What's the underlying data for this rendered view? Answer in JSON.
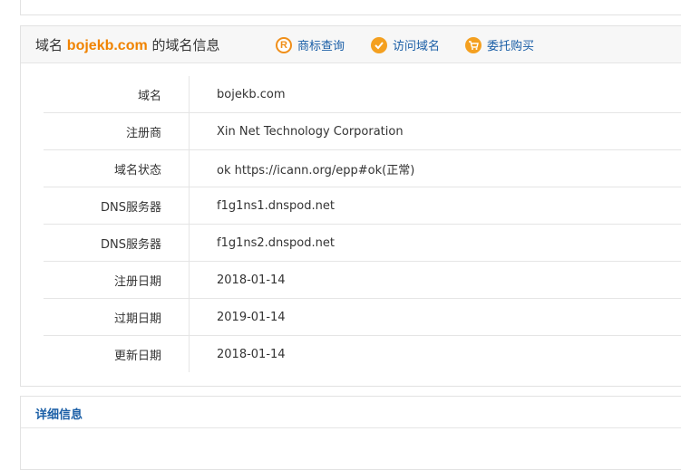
{
  "header": {
    "prefix": "域名",
    "domain": "bojekb.com",
    "suffix": "的域名信息",
    "actions": [
      {
        "label": "商标查询",
        "icon": "trademark-r-icon"
      },
      {
        "label": "访问域名",
        "icon": "visit-icon"
      },
      {
        "label": "委托购买",
        "icon": "shopping-cart-icon"
      }
    ]
  },
  "rows": [
    {
      "label": "域名",
      "value": "bojekb.com"
    },
    {
      "label": "注册商",
      "value": "Xin Net Technology Corporation"
    },
    {
      "label": "域名状态",
      "value": "ok https://icann.org/epp#ok(正常)"
    },
    {
      "label": "DNS服务器",
      "value": "f1g1ns1.dnspod.net"
    },
    {
      "label": "DNS服务器",
      "value": "f1g1ns2.dnspod.net"
    },
    {
      "label": "注册日期",
      "value": "2018-01-14"
    },
    {
      "label": "过期日期",
      "value": "2019-01-14"
    },
    {
      "label": "更新日期",
      "value": "2018-01-14"
    }
  ],
  "detail": {
    "title": "详细信息"
  },
  "colors": {
    "accent": "#f08300",
    "link": "#1a5ea6",
    "border": "#e5e5e5"
  }
}
